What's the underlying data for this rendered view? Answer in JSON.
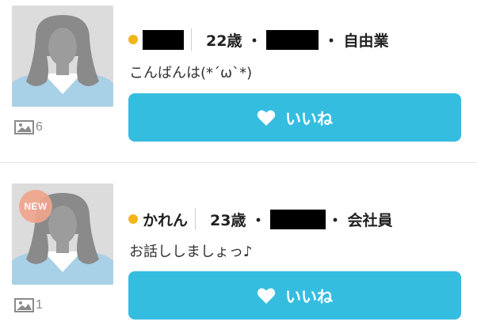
{
  "profiles": [
    {
      "name": "",
      "age": "22歳",
      "occupation": "自由業",
      "message": "こんばんは(*´ω`*)",
      "photo_count": "6",
      "like_label": "いいね",
      "is_new": false
    },
    {
      "name": "かれん",
      "age": "23歳",
      "occupation": "会社員",
      "message": "お話ししましょっ♪",
      "photo_count": "1",
      "like_label": "いいね",
      "is_new": true,
      "badge": "NEW"
    }
  ],
  "separator": "・",
  "colors": {
    "accent": "#35bde0",
    "online_dot": "#f2b51c",
    "new_badge": "#f0a48c",
    "redaction": "#000000"
  },
  "icons": [
    "image-icon",
    "heart-icon",
    "avatar-silhouette"
  ]
}
